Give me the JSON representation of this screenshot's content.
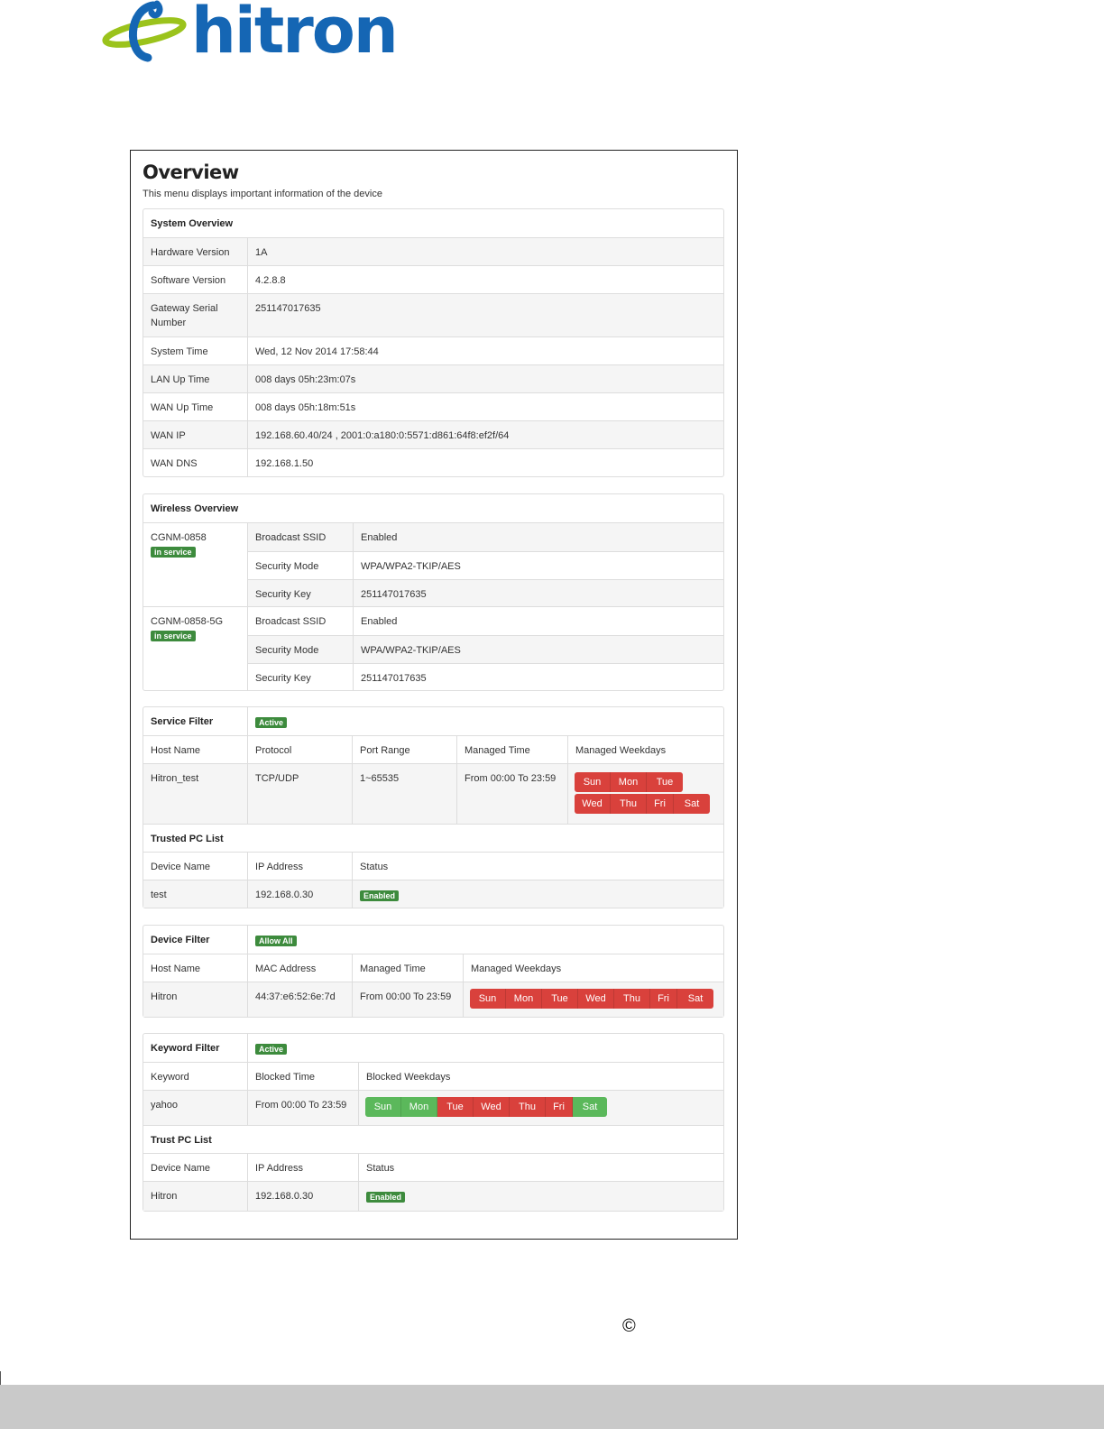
{
  "brand": {
    "logo_text": "hitron",
    "logo_color": "#1566b4",
    "swoosh_color": "#9bc31c"
  },
  "page": {
    "title": "Overview",
    "subtitle": "This menu displays important information of the device"
  },
  "system_overview": {
    "heading": "System Overview",
    "rows": [
      {
        "label": "Hardware Version",
        "value": "1A"
      },
      {
        "label": "Software Version",
        "value": "4.2.8.8"
      },
      {
        "label": "Gateway Serial Number",
        "value": "251147017635"
      },
      {
        "label": "System Time",
        "value": "Wed, 12 Nov 2014 17:58:44"
      },
      {
        "label": "LAN Up Time",
        "value": "008 days 05h:23m:07s"
      },
      {
        "label": "WAN Up Time",
        "value": "008 days 05h:18m:51s"
      },
      {
        "label": "WAN IP",
        "value": "192.168.60.40/24 , 2001:0:a180:0:5571:d861:64f8:ef2f/64"
      },
      {
        "label": "WAN DNS",
        "value": "192.168.1.50"
      }
    ]
  },
  "wireless_overview": {
    "heading": "Wireless Overview",
    "networks": [
      {
        "ssid": "CGNM-0858",
        "badge": "in service",
        "rows": [
          {
            "label": "Broadcast SSID",
            "value": "Enabled"
          },
          {
            "label": "Security Mode",
            "value": "WPA/WPA2-TKIP/AES"
          },
          {
            "label": "Security Key",
            "value": "251147017635"
          }
        ]
      },
      {
        "ssid": "CGNM-0858-5G",
        "badge": "in service",
        "rows": [
          {
            "label": "Broadcast SSID",
            "value": "Enabled"
          },
          {
            "label": "Security Mode",
            "value": "WPA/WPA2-TKIP/AES"
          },
          {
            "label": "Security Key",
            "value": "251147017635"
          }
        ]
      }
    ]
  },
  "service_filter": {
    "heading": "Service Filter",
    "status_badge": "Active",
    "columns": [
      "Host Name",
      "Protocol",
      "Port Range",
      "Managed Time",
      "Managed Weekdays"
    ],
    "entry": {
      "host": "Hitron_test",
      "protocol": "TCP/UDP",
      "port_range": "1~65535",
      "time": "From 00:00 To 23:59"
    },
    "weekdays_row1": [
      "Sun",
      "Mon",
      "Tue"
    ],
    "weekdays_row2": [
      "Wed",
      "Thu",
      "Fri",
      "Sat"
    ],
    "trusted_heading": "Trusted PC List",
    "trusted_columns": [
      "Device Name",
      "IP Address",
      "Status"
    ],
    "trusted_entry": {
      "device": "test",
      "ip": "192.168.0.30",
      "status": "Enabled"
    }
  },
  "device_filter": {
    "heading": "Device Filter",
    "status_badge": "Allow All",
    "columns": [
      "Host Name",
      "MAC Address",
      "Managed Time",
      "Managed Weekdays"
    ],
    "entry": {
      "host": "Hitron",
      "mac": "44:37:e6:52:6e:7d",
      "time": "From 00:00 To 23:59"
    },
    "weekdays": [
      "Sun",
      "Mon",
      "Tue",
      "Wed",
      "Thu",
      "Fri",
      "Sat"
    ]
  },
  "keyword_filter": {
    "heading": "Keyword Filter",
    "status_badge": "Active",
    "columns": [
      "Keyword",
      "Blocked Time",
      "Blocked Weekdays"
    ],
    "entry": {
      "keyword": "yahoo",
      "time": "From 00:00 To 23:59"
    },
    "weekdays": [
      "Sun",
      "Mon",
      "Tue",
      "Wed",
      "Thu",
      "Fri",
      "Sat"
    ],
    "weekday_states": [
      "off",
      "off",
      "on",
      "on",
      "on",
      "on",
      "off"
    ],
    "trust_heading": "Trust PC List",
    "trust_columns": [
      "Device Name",
      "IP Address",
      "Status"
    ],
    "trust_entry": {
      "device": "Hitron",
      "ip": "192.168.0.30",
      "status": "Enabled"
    }
  },
  "colors": {
    "day_blocked": "#d9413c",
    "day_allowed": "#5bb85b",
    "badge_green": "#3d8b3d"
  },
  "footer": {
    "copyright_symbol": "©"
  }
}
